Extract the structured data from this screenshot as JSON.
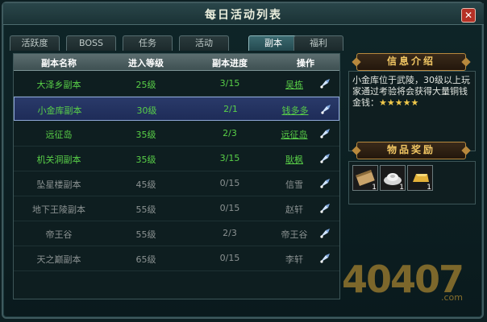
{
  "window": {
    "title": "每日活动列表",
    "close_label": "✕"
  },
  "tabs": [
    {
      "label": "活跃度",
      "active": false
    },
    {
      "label": "BOSS",
      "active": false
    },
    {
      "label": "任务",
      "active": false
    },
    {
      "label": "活动",
      "active": false
    },
    {
      "label": "副本",
      "active": true
    },
    {
      "label": "福利",
      "active": false
    }
  ],
  "table": {
    "headers": [
      "副本名称",
      "进入等级",
      "副本进度",
      "操作"
    ],
    "rows": [
      {
        "name": "大泽乡副本",
        "level": "25级",
        "progress": "3/15",
        "action": "吴栋",
        "status": "available"
      },
      {
        "name": "小金库副本",
        "level": "30级",
        "progress": "2/1",
        "action": "钱多多",
        "status": "selected"
      },
      {
        "name": "远征岛",
        "level": "35级",
        "progress": "2/3",
        "action": "远征岛",
        "status": "available"
      },
      {
        "name": "机关洞副本",
        "level": "35级",
        "progress": "3/15",
        "action": "耿枫",
        "status": "available"
      },
      {
        "name": "坠星楼副本",
        "level": "45级",
        "progress": "0/15",
        "action": "信雪",
        "status": "locked"
      },
      {
        "name": "地下王陵副本",
        "level": "55级",
        "progress": "0/15",
        "action": "赵轩",
        "status": "locked"
      },
      {
        "name": "帝王谷",
        "level": "55级",
        "progress": "2/3",
        "action": "帝王谷",
        "status": "locked"
      },
      {
        "name": "天之巅副本",
        "level": "65级",
        "progress": "0/15",
        "action": "李轩",
        "status": "locked"
      }
    ]
  },
  "info": {
    "header": "信息介绍",
    "text": "小金库位于武陵，30级以上玩家通过考验将会获得大量铜钱",
    "reward_label": "金钱：",
    "stars": "★★★★★"
  },
  "rewards": {
    "header": "物品奖励",
    "items": [
      {
        "icon": "scroll-icon",
        "qty": "1"
      },
      {
        "icon": "silver-ingot-icon",
        "qty": "1"
      },
      {
        "icon": "gold-bar-icon",
        "qty": "1"
      }
    ]
  },
  "watermark": {
    "text": "40407",
    "suffix": ".com"
  }
}
